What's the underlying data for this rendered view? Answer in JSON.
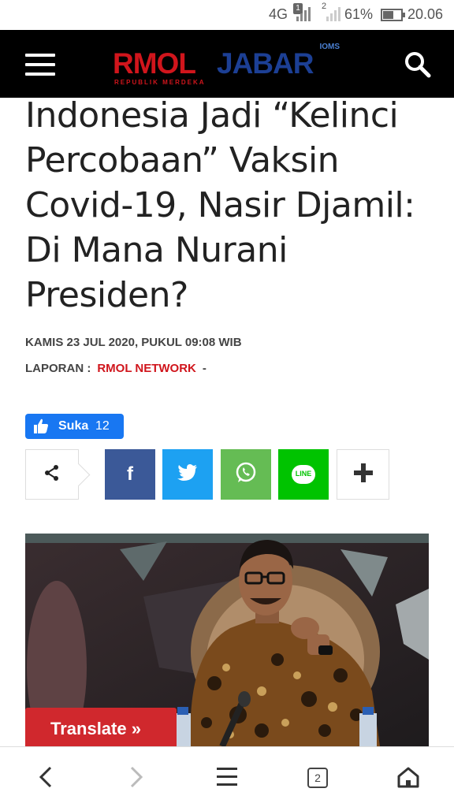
{
  "status_bar": {
    "network": "4G",
    "sim1": "1",
    "sim2": "2",
    "battery": "61%",
    "battery_level": 0.61,
    "time": "20.06"
  },
  "header": {
    "logo_rmol": "RMOL",
    "logo_jabar": "JABAR",
    "logo_tagline": "REPUBLIK MERDEKA",
    "logo_network": "IOMS",
    "menu_icon": "hamburger-icon",
    "search_icon": "search-icon"
  },
  "article": {
    "title": "Indonesia Jadi “Kelinci Percobaan” Vaksin Covid-19, Nasir Djamil: Di Mana Nurani Presiden?",
    "date": "KAMIS 23 JUL 2020, PUKUL 09:08 WIB",
    "reporter_label": "LAPORAN :",
    "reporter": "RMOL NETWORK",
    "reporter_suffix": "-"
  },
  "like": {
    "label": "Suka",
    "count": "12",
    "icon": "thumbs-up-icon"
  },
  "share": {
    "icons": [
      "share-icon",
      "facebook-icon",
      "twitter-icon",
      "whatsapp-icon",
      "line-icon",
      "plus-icon"
    ],
    "line_text": "LINE",
    "colors": {
      "facebook": "#3b5998",
      "twitter": "#1da1f2",
      "whatsapp": "#65bc54",
      "line": "#00c300"
    }
  },
  "translate": {
    "label": "Translate »"
  },
  "bottom_nav": {
    "tab_count": "2",
    "icons": [
      "back-icon",
      "forward-icon",
      "menu-icon",
      "tabs-icon",
      "home-icon"
    ]
  },
  "colors": {
    "header_bg": "#000000",
    "brand_red": "#d0151c",
    "brand_blue": "#1c3f94",
    "translate_bg": "#d0282d",
    "like_bg": "#1877f2"
  }
}
